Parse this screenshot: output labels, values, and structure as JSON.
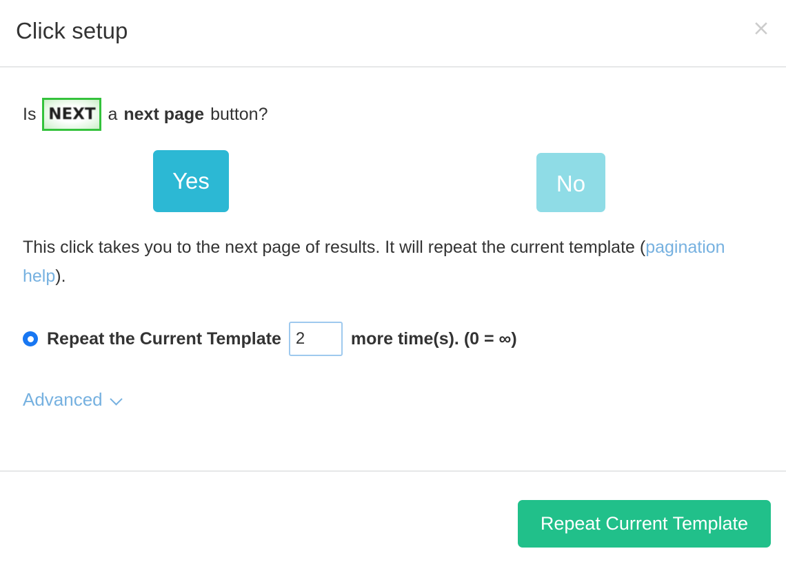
{
  "header": {
    "title": "Click setup",
    "close_label": "×"
  },
  "question": {
    "prefix": "Is",
    "target_label": "NEXT",
    "middle": "a",
    "emphasis": "next page",
    "suffix": "button?"
  },
  "choices": {
    "yes_label": "Yes",
    "no_label": "No"
  },
  "description": {
    "text_before_link": "This click takes you to the next page of results. It will repeat the current template (",
    "link_label": "pagination help",
    "text_after_link": ")."
  },
  "repeat": {
    "radio_selected": true,
    "label": "Repeat the Current Template",
    "value": "2",
    "placeholder": "",
    "suffix": "more time(s). (0 = ∞)"
  },
  "advanced": {
    "label": "Advanced",
    "icon": "chevron-down-icon"
  },
  "footer": {
    "primary_label": "Repeat Current Template"
  },
  "colors": {
    "teal_active": "#2cb8d4",
    "teal_inactive": "#8fdce6",
    "green_primary": "#21c08a",
    "highlight_green": "#34c23c",
    "link_blue": "#76b1e0",
    "radio_blue": "#1877f2",
    "input_border_blue": "#9ec9ee",
    "divider_gray": "#e6e7e8",
    "text_dark": "#333333",
    "close_gray": "#cccccc"
  }
}
